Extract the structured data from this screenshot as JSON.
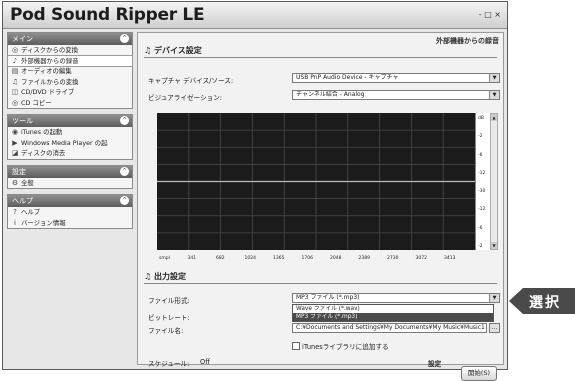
{
  "app_title": "Pod Sound Ripper LE",
  "window_controls": "- □ ×",
  "sidebar": {
    "panels": [
      {
        "title": "メイン",
        "items": [
          {
            "label": "ディスクからの変換",
            "icon": "disc-icon"
          },
          {
            "label": "外部機器からの録音",
            "icon": "microphone-icon",
            "selected": true
          },
          {
            "label": "オーディオの編集",
            "icon": "waveform-icon"
          },
          {
            "label": "ファイルからの変換",
            "icon": "music-note-icon"
          },
          {
            "label": "CD/DVD ドライブ",
            "icon": "drive-icon"
          },
          {
            "label": "CD コピー",
            "icon": "cd-copy-icon"
          }
        ]
      },
      {
        "title": "ツール",
        "items": [
          {
            "label": "iTunes の起動",
            "icon": "itunes-icon"
          },
          {
            "label": "Windows Media Player の起",
            "icon": "media-player-icon"
          },
          {
            "label": "ディスクの消去",
            "icon": "eraser-icon"
          }
        ]
      },
      {
        "title": "設定",
        "items": [
          {
            "label": "全般",
            "icon": "gear-icon"
          }
        ]
      },
      {
        "title": "ヘルプ",
        "items": [
          {
            "label": "ヘルプ",
            "icon": "help-icon"
          },
          {
            "label": "バージョン情報",
            "icon": "info-icon"
          }
        ]
      }
    ]
  },
  "content": {
    "page_title": "外部機器からの録音",
    "device_section": {
      "title": "デバイス設定",
      "capture_label": "キャプチャ デバイス/ソース:",
      "capture_value": "USB PnP Audio Device - キャプチャ",
      "equalizer_label": "ビジュアライゼーション:",
      "equalizer_value": "チャンネル結合 - Analog"
    },
    "equalizer": {
      "scale_labels": [
        "dB",
        "-2",
        "-6",
        "-12",
        "-30",
        "-12",
        "-6",
        "-2"
      ],
      "freq_labels": [
        "smpl",
        "341",
        "682",
        "1024",
        "1365",
        "1706",
        "2048",
        "2389",
        "2730",
        "3072",
        "3413"
      ]
    },
    "output_section": {
      "title": "出力設定",
      "format_label": "ファイル形式:",
      "format_value": "MP3 ファイル (*.mp3)",
      "format_options": [
        "Wave ファイル (*.wav)",
        "MP3 ファイル (*.mp3)"
      ],
      "format_selected_index": 1,
      "bitrate_label": "ビットレート:",
      "filename_label": "ファイル名:",
      "filename_value": "C:¥Documents and Settings¥My Documents¥My Music¥Music1",
      "browse_label": "...",
      "itunes_checkbox_label": "iTunesライブラリに追加する",
      "schedule_label": "スケジュール:",
      "schedule_value": "Off",
      "settings_label": "設定",
      "start_button": "開始(S)"
    }
  },
  "callout": {
    "text": "選択",
    "color": "#4a4a4a"
  }
}
